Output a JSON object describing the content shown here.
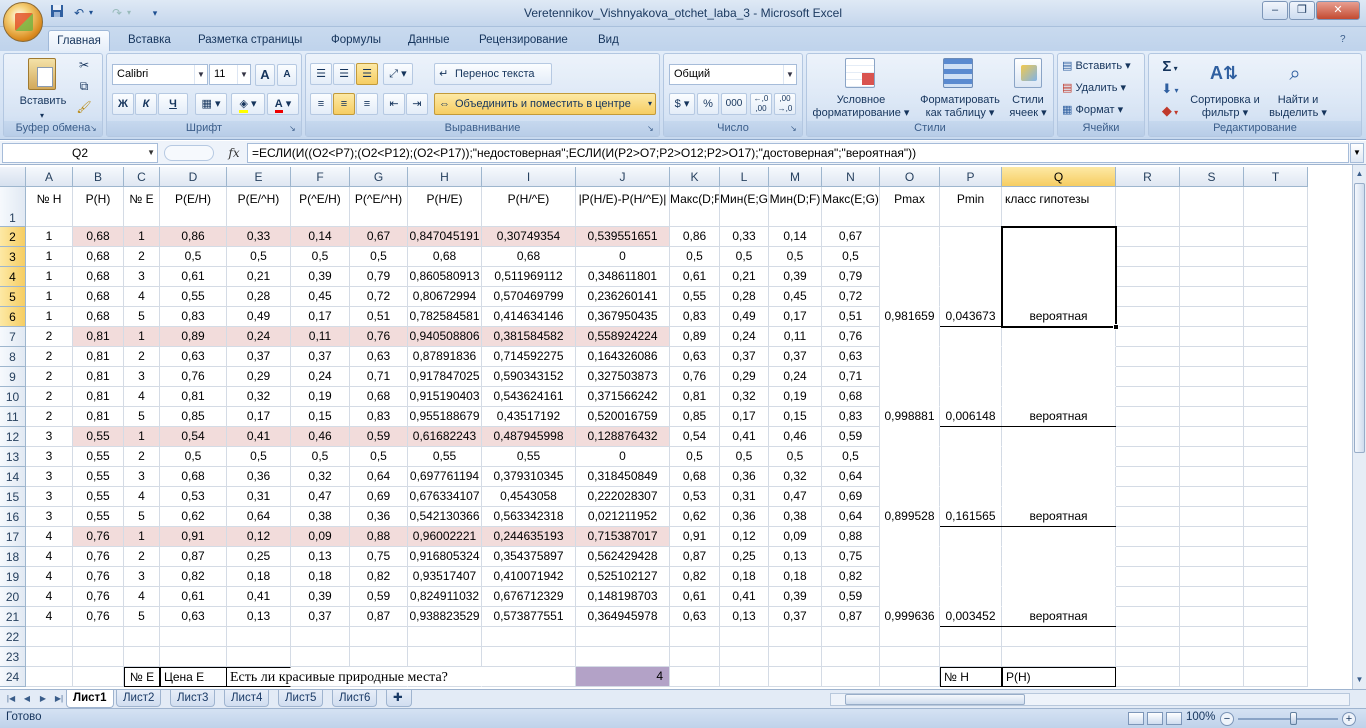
{
  "window": {
    "title": "Veretennikov_Vishnyakova_otchet_laba_3 - Microsoft Excel",
    "minimize": "–",
    "restore": "❐",
    "close": "✕"
  },
  "qat": {
    "save_icon": "floppy-icon",
    "undo": "↶",
    "redo": "↷",
    "customize": "▾"
  },
  "tabs": [
    "Главная",
    "Вставка",
    "Разметка страницы",
    "Формулы",
    "Данные",
    "Рецензирование",
    "Вид"
  ],
  "ribbon": {
    "clipboard": {
      "label": "Буфер обмена",
      "paste": "Вставить"
    },
    "font": {
      "label": "Шрифт",
      "font_name": "Calibri",
      "font_size": "11",
      "grow": "A",
      "shrink": "A",
      "bold": "Ж",
      "italic": "К",
      "underline": "Ч"
    },
    "alignment": {
      "label": "Выравнивание",
      "wrap": "Перенос текста",
      "merge": "Объединить и поместить в центре"
    },
    "number": {
      "label": "Число",
      "format": "Общий",
      "currency": "$",
      "percent": "%",
      "thousands": "000"
    },
    "styles": {
      "label": "Стили",
      "conditional": "Условное форматирование",
      "as_table": "Форматировать как таблицу",
      "cell_styles": "Стили ячеек"
    },
    "cells": {
      "label": "Ячейки",
      "insert": "Вставить",
      "delete": "Удалить",
      "format": "Формат"
    },
    "editing": {
      "label": "Редактирование",
      "sum": "Σ",
      "sort": "Сортировка и фильтр",
      "find": "Найти и выделить"
    }
  },
  "formula_bar": {
    "name_box": "Q2",
    "fx": "fx",
    "formula": "=ЕСЛИ(И((O2<P7);(O2<P12);(O2<P17));\"недостоверная\";ЕСЛИ(И(P2>O7;P2>O12;P2>O17);\"достоверная\";\"вероятная\"))"
  },
  "grid": {
    "columns": [
      "A",
      "B",
      "C",
      "D",
      "E",
      "F",
      "G",
      "H",
      "I",
      "J",
      "K",
      "L",
      "M",
      "N",
      "O",
      "P",
      "Q",
      "R",
      "S",
      "T"
    ],
    "rows": [
      "1",
      "2",
      "3",
      "4",
      "5",
      "6",
      "7",
      "8",
      "9",
      "10",
      "11",
      "12",
      "13",
      "14",
      "15",
      "16",
      "17",
      "18",
      "19",
      "20",
      "21",
      "22",
      "23",
      "24"
    ],
    "header": [
      "№ H",
      "P(H)",
      "№ E",
      "P(E/H)",
      "P(E/^H)",
      "P(^E/H)",
      "P(^E/^H)",
      "P(H/E)",
      "P(H/^E)",
      "|P(H/E)-P(H/^E)|",
      "Макс(D;F)",
      "Мин(E;G)",
      "Мин(D;F)",
      "Макс(E;G)",
      "Pmax",
      "Pmin",
      "класс гипотезы"
    ],
    "data": [
      [
        "1",
        "0,68",
        "1",
        "0,86",
        "0,33",
        "0,14",
        "0,67",
        "0,847045191",
        "0,30749354",
        "0,539551651",
        "0,86",
        "0,33",
        "0,14",
        "0,67"
      ],
      [
        "1",
        "0,68",
        "2",
        "0,5",
        "0,5",
        "0,5",
        "0,5",
        "0,68",
        "0,68",
        "0",
        "0,5",
        "0,5",
        "0,5",
        "0,5"
      ],
      [
        "1",
        "0,68",
        "3",
        "0,61",
        "0,21",
        "0,39",
        "0,79",
        "0,860580913",
        "0,511969112",
        "0,348611801",
        "0,61",
        "0,21",
        "0,39",
        "0,79"
      ],
      [
        "1",
        "0,68",
        "4",
        "0,55",
        "0,28",
        "0,45",
        "0,72",
        "0,80672994",
        "0,570469799",
        "0,236260141",
        "0,55",
        "0,28",
        "0,45",
        "0,72"
      ],
      [
        "1",
        "0,68",
        "5",
        "0,83",
        "0,49",
        "0,17",
        "0,51",
        "0,782584581",
        "0,414634146",
        "0,367950435",
        "0,83",
        "0,49",
        "0,17",
        "0,51"
      ],
      [
        "2",
        "0,81",
        "1",
        "0,89",
        "0,24",
        "0,11",
        "0,76",
        "0,940508806",
        "0,381584582",
        "0,558924224",
        "0,89",
        "0,24",
        "0,11",
        "0,76"
      ],
      [
        "2",
        "0,81",
        "2",
        "0,63",
        "0,37",
        "0,37",
        "0,63",
        "0,87891836",
        "0,714592275",
        "0,164326086",
        "0,63",
        "0,37",
        "0,37",
        "0,63"
      ],
      [
        "2",
        "0,81",
        "3",
        "0,76",
        "0,29",
        "0,24",
        "0,71",
        "0,917847025",
        "0,590343152",
        "0,327503873",
        "0,76",
        "0,29",
        "0,24",
        "0,71"
      ],
      [
        "2",
        "0,81",
        "4",
        "0,81",
        "0,32",
        "0,19",
        "0,68",
        "0,915190403",
        "0,543624161",
        "0,371566242",
        "0,81",
        "0,32",
        "0,19",
        "0,68"
      ],
      [
        "2",
        "0,81",
        "5",
        "0,85",
        "0,17",
        "0,15",
        "0,83",
        "0,955188679",
        "0,43517192",
        "0,520016759",
        "0,85",
        "0,17",
        "0,15",
        "0,83"
      ],
      [
        "3",
        "0,55",
        "1",
        "0,54",
        "0,41",
        "0,46",
        "0,59",
        "0,61682243",
        "0,487945998",
        "0,128876432",
        "0,54",
        "0,41",
        "0,46",
        "0,59"
      ],
      [
        "3",
        "0,55",
        "2",
        "0,5",
        "0,5",
        "0,5",
        "0,5",
        "0,55",
        "0,55",
        "0",
        "0,5",
        "0,5",
        "0,5",
        "0,5"
      ],
      [
        "3",
        "0,55",
        "3",
        "0,68",
        "0,36",
        "0,32",
        "0,64",
        "0,697761194",
        "0,379310345",
        "0,318450849",
        "0,68",
        "0,36",
        "0,32",
        "0,64"
      ],
      [
        "3",
        "0,55",
        "4",
        "0,53",
        "0,31",
        "0,47",
        "0,69",
        "0,676334107",
        "0,4543058",
        "0,222028307",
        "0,53",
        "0,31",
        "0,47",
        "0,69"
      ],
      [
        "3",
        "0,55",
        "5",
        "0,62",
        "0,64",
        "0,38",
        "0,36",
        "0,542130366",
        "0,563342318",
        "0,021211952",
        "0,62",
        "0,36",
        "0,38",
        "0,64"
      ],
      [
        "4",
        "0,76",
        "1",
        "0,91",
        "0,12",
        "0,09",
        "0,88",
        "0,96002221",
        "0,244635193",
        "0,715387017",
        "0,91",
        "0,12",
        "0,09",
        "0,88"
      ],
      [
        "4",
        "0,76",
        "2",
        "0,87",
        "0,25",
        "0,13",
        "0,75",
        "0,916805324",
        "0,354375897",
        "0,562429428",
        "0,87",
        "0,25",
        "0,13",
        "0,75"
      ],
      [
        "4",
        "0,76",
        "3",
        "0,82",
        "0,18",
        "0,18",
        "0,82",
        "0,93517407",
        "0,410071942",
        "0,525102127",
        "0,82",
        "0,18",
        "0,18",
        "0,82"
      ],
      [
        "4",
        "0,76",
        "4",
        "0,61",
        "0,41",
        "0,39",
        "0,59",
        "0,824911032",
        "0,676712329",
        "0,148198703",
        "0,61",
        "0,41",
        "0,39",
        "0,59"
      ],
      [
        "4",
        "0,76",
        "5",
        "0,63",
        "0,13",
        "0,37",
        "0,87",
        "0,938823529",
        "0,573877551",
        "0,364945978",
        "0,63",
        "0,13",
        "0,37",
        "0,87"
      ]
    ],
    "summary": [
      {
        "row": 6,
        "pmax": "0,981659",
        "pmin": "0,043673",
        "class": "вероятная"
      },
      {
        "row": 11,
        "pmax": "0,998881",
        "pmin": "0,006148",
        "class": "вероятная"
      },
      {
        "row": 16,
        "pmax": "0,899528",
        "pmin": "0,161565",
        "class": "вероятная"
      },
      {
        "row": 21,
        "pmax": "0,999636",
        "pmin": "0,003452",
        "class": "вероятная"
      }
    ],
    "row24": {
      "c": "№ E",
      "d": "Цена E",
      "e": "Есть ли красивые природные места?",
      "j": "4",
      "p": "№ H",
      "q": "P(H)"
    }
  },
  "sheets": [
    "Лист1",
    "Лист2",
    "Лист3",
    "Лист4",
    "Лист5",
    "Лист6"
  ],
  "status": {
    "text": "Готово",
    "zoom": "100%"
  },
  "colors": {
    "pink": "#f2dcdb",
    "lilac": "#b3a2c7",
    "selected_header": "#f6cd62"
  }
}
